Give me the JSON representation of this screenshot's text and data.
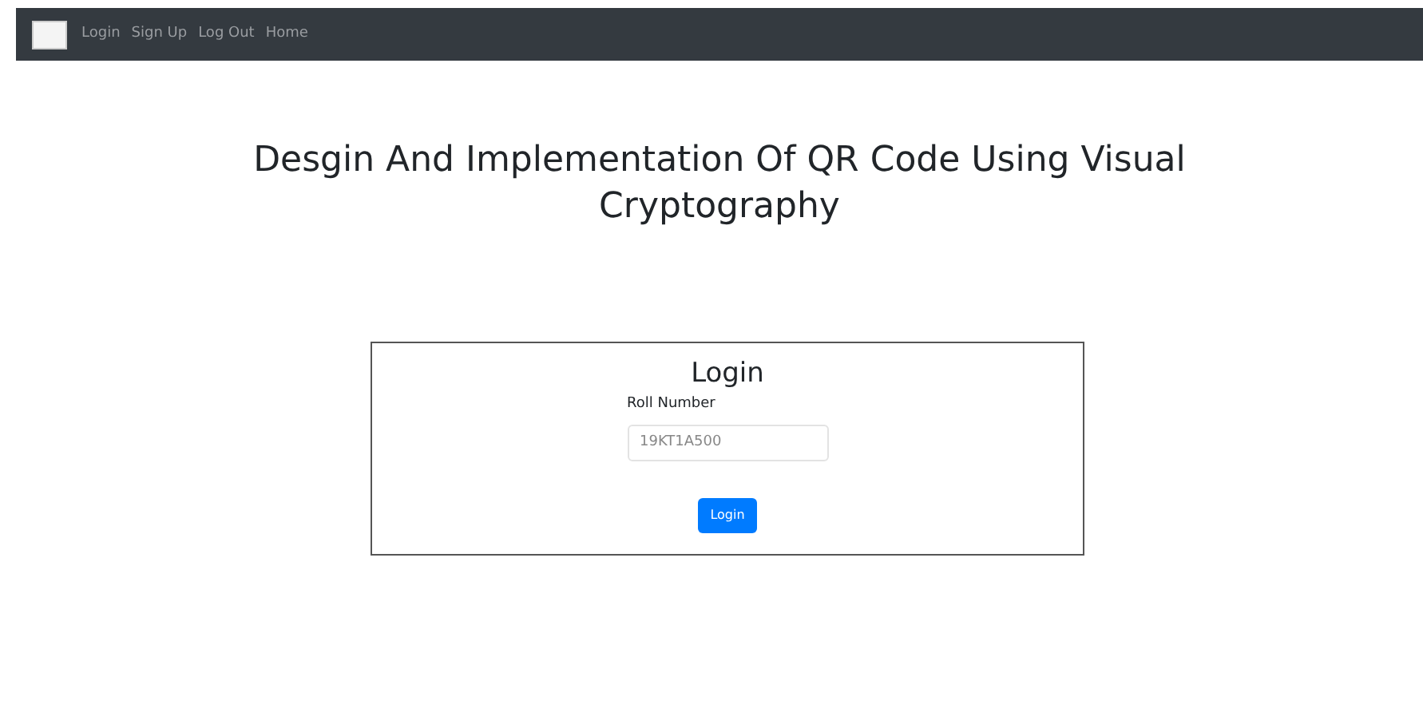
{
  "navbar": {
    "links": [
      "Login",
      "Sign Up",
      "Log Out",
      "Home"
    ]
  },
  "heading": "Desgin And Implementation Of QR Code Using Visual Cryptography",
  "login_form": {
    "title": "Login",
    "field": {
      "label": "Roll Number",
      "placeholder": "19KT1A500"
    },
    "button": "Login"
  }
}
